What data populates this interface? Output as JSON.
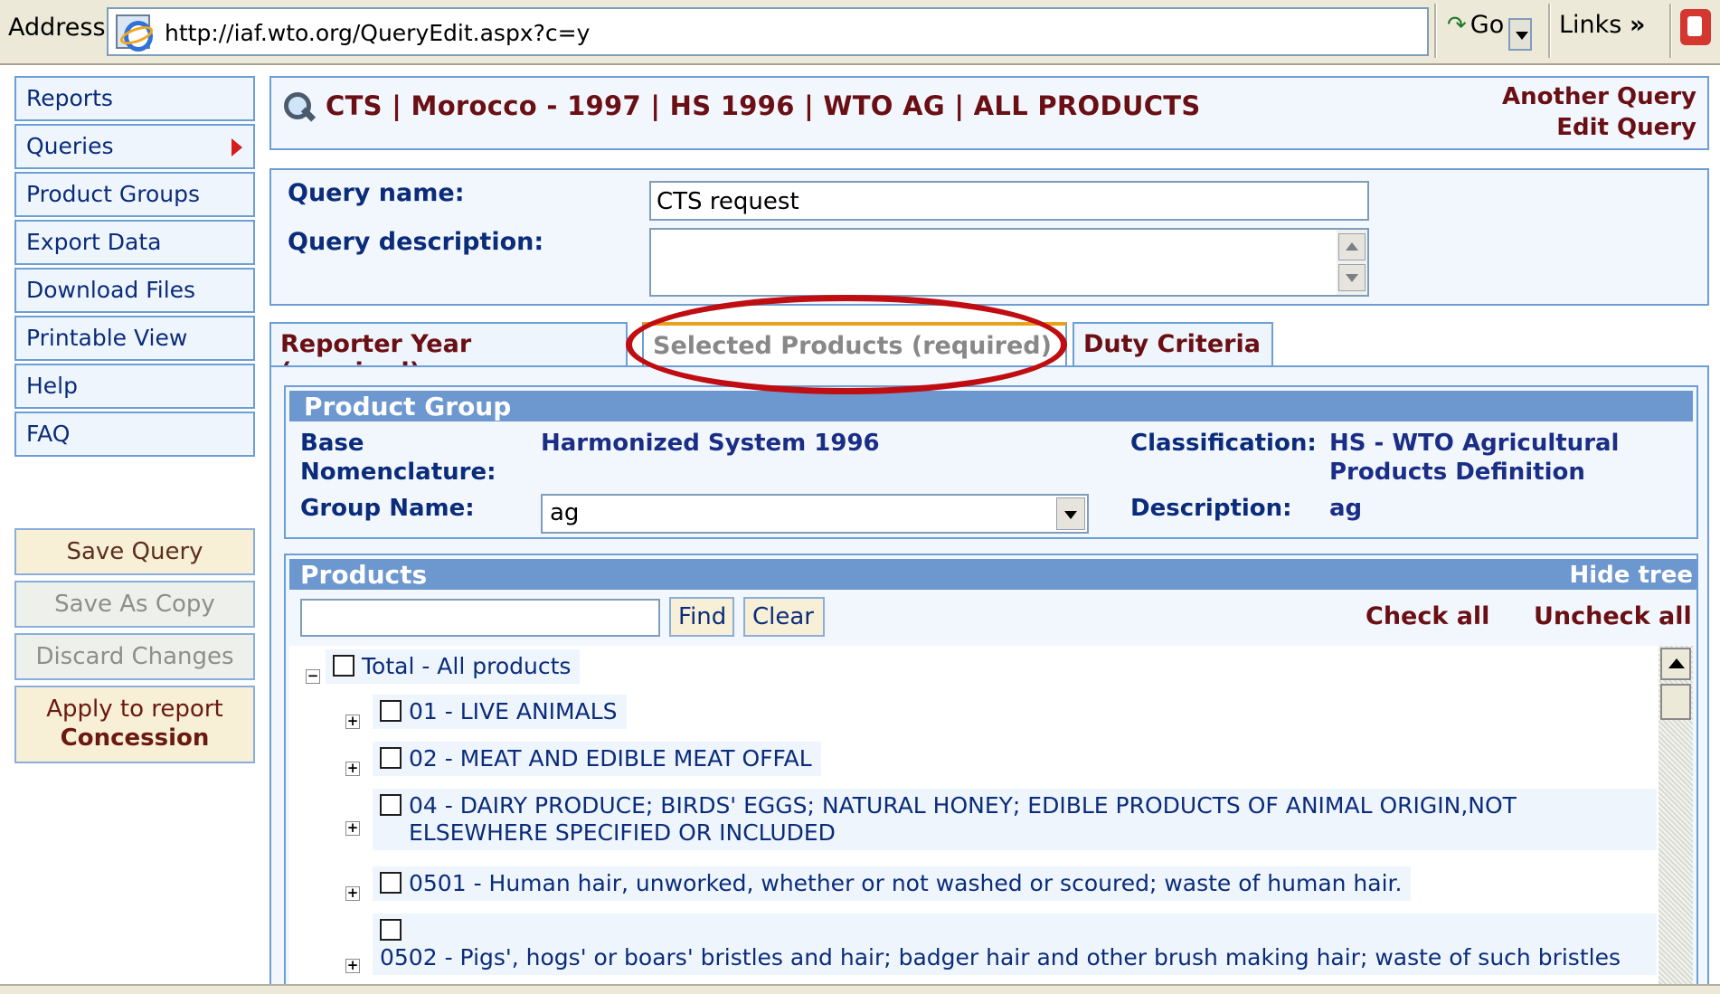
{
  "browser": {
    "address_label": "Address",
    "url": "http://iaf.wto.org/QueryEdit.aspx?c=y",
    "go_label": "Go",
    "links_label": "Links",
    "links_chevron": "»"
  },
  "nav": {
    "items": [
      "Reports",
      "Queries",
      "Product Groups",
      "Export Data",
      "Download Files",
      "Printable View",
      "Help",
      "FAQ"
    ],
    "actions": {
      "save_query": "Save Query",
      "save_as_copy": "Save As Copy",
      "discard_changes": "Discard Changes",
      "apply_line1": "Apply to report",
      "apply_line2": "Concession"
    }
  },
  "header": {
    "breadcrumb": "CTS | Morocco - 1997 | HS 1996 | WTO AG | ALL PRODUCTS",
    "another_query": "Another Query",
    "edit_query": "Edit Query"
  },
  "query": {
    "name_label": "Query name:",
    "name_value": "CTS request",
    "description_label": "Query description:",
    "description_value": ""
  },
  "tabs": [
    {
      "label": "Reporter Year (required)",
      "active": false
    },
    {
      "label": "Selected Products (required)",
      "active": true
    },
    {
      "label": "Duty Criteria",
      "active": false
    }
  ],
  "product_group": {
    "title": "Product Group",
    "base_label": "Base Nomenclature:",
    "base_label_line1": "Base",
    "base_label_line2": "Nomenclature:",
    "base_value": "Harmonized System 1996",
    "classification_label": "Classification:",
    "classification_line1": "HS - WTO Agricultural",
    "classification_line2": "Products Definition",
    "group_name_label": "Group Name:",
    "group_name_value": "ag",
    "description_label": "Description:",
    "description_value": "ag"
  },
  "products": {
    "title": "Products",
    "hide_tree": "Hide tree",
    "find_value": "",
    "find_button": "Find",
    "clear_button": "Clear",
    "check_all": "Check all",
    "uncheck_all": "Uncheck all",
    "tree": [
      {
        "label": "Total - All products",
        "expander": "−",
        "checked": false
      },
      {
        "label": "01 - LIVE ANIMALS",
        "expander": "+",
        "checked": false
      },
      {
        "label": "02 - MEAT AND EDIBLE MEAT OFFAL",
        "expander": "+",
        "checked": false
      },
      {
        "label": "04 - DAIRY PRODUCE; BIRDS' EGGS; NATURAL HONEY; EDIBLE PRODUCTS OF ANIMAL ORIGIN,NOT ELSEWHERE SPECIFIED OR INCLUDED",
        "line1": "04 - DAIRY PRODUCE; BIRDS' EGGS; NATURAL HONEY; EDIBLE PRODUCTS OF ANIMAL ORIGIN,NOT",
        "line2": "ELSEWHERE SPECIFIED OR INCLUDED",
        "expander": "+",
        "checked": false
      },
      {
        "label": "0501 - Human hair, unworked, whether or not washed or scoured; waste of human hair.",
        "expander": "+",
        "checked": false
      },
      {
        "label": "0502 - Pigs', hogs' or boars' bristles and hair; badger hair and other brush making hair; waste of such bristles",
        "expander": "+",
        "checked": false
      }
    ]
  },
  "colors": {
    "panel_border": "#6d9ed6",
    "section_header": "#6c97cf",
    "accent_dark_red": "#6a0f14",
    "highlight_oval": "#c00d12"
  }
}
